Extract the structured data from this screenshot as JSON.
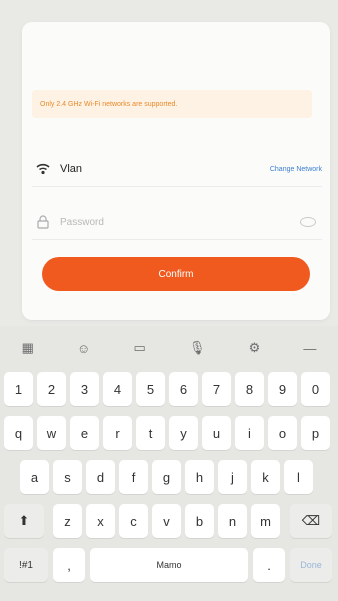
{
  "card": {
    "warning_text": "Only 2.4 GHz Wi-Fi networks are supported.",
    "wifi": {
      "ssid": "Vlan",
      "change_network": "Change Network"
    },
    "password": {
      "placeholder": "Password"
    },
    "confirm_label": "Confirm"
  },
  "keyboard": {
    "toolbar": [
      "menu-icon",
      "emoji-icon",
      "clipboard-icon",
      "mic-icon",
      "settings-icon",
      "collapse-icon"
    ],
    "numbers": [
      "1",
      "2",
      "3",
      "4",
      "5",
      "6",
      "7",
      "8",
      "9",
      "0"
    ],
    "row1": [
      "q",
      "w",
      "e",
      "r",
      "t",
      "y",
      "u",
      "i",
      "o",
      "p"
    ],
    "row2": [
      "a",
      "s",
      "d",
      "f",
      "g",
      "h",
      "j",
      "k",
      "l"
    ],
    "row3": [
      "z",
      "x",
      "c",
      "v",
      "b",
      "n",
      "m"
    ],
    "bottom": {
      "symbols": "!#1",
      "comma": ",",
      "space": "Mamo",
      "period": ".",
      "done": "Done"
    },
    "colors": {
      "accent": "#f05a1f",
      "warning": "#e98a2b",
      "link": "#3c7fd1"
    }
  }
}
